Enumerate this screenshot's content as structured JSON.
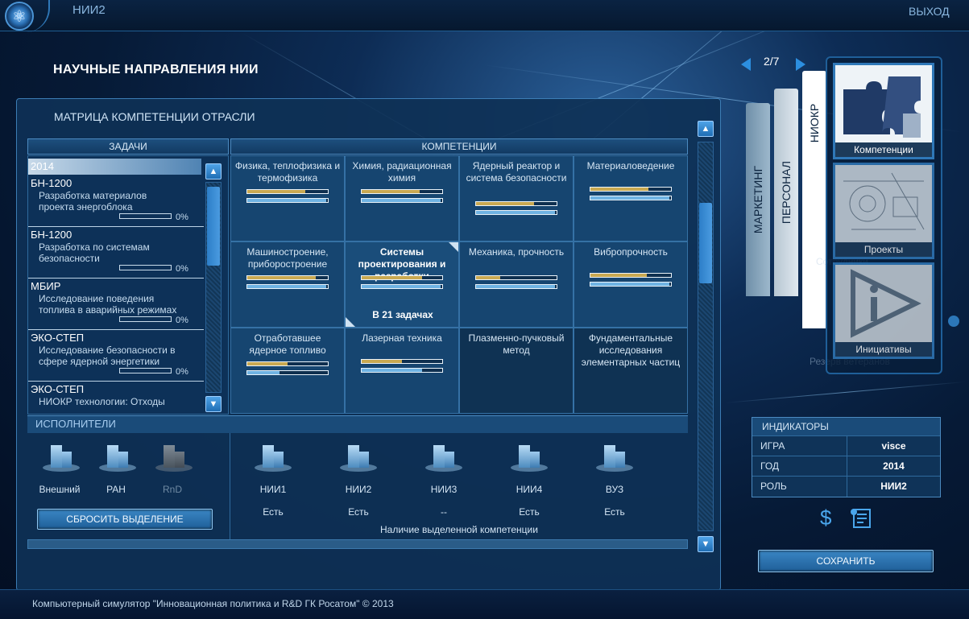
{
  "app": {
    "title": "НИИ2",
    "exit_label": "ВЫХОД",
    "logo_icon": "atom-icon"
  },
  "page_title": "НАУЧНЫЕ НАПРАВЛЕНИЯ НИИ",
  "panel_title": "МАТРИЦА КОМПЕТЕНЦИИ ОТРАСЛИ",
  "headers": {
    "tasks": "ЗАДАЧИ",
    "competencies": "КОМПЕТЕНЦИИ",
    "executors": "ИСПОЛНИТЕЛИ"
  },
  "tasks": {
    "year": "2014",
    "items": [
      {
        "code": "БН-1200",
        "desc": "Разработка материалов проекта энергоблока",
        "progress": "0%"
      },
      {
        "code": "БН-1200",
        "desc": "Разработка по системам безопасности",
        "progress": "0%"
      },
      {
        "code": "МБИР",
        "desc": "Исследование поведения топлива в аварийных режимах",
        "progress": "0%"
      },
      {
        "code": "ЭКО-СТЕП",
        "desc": "Исследование безопасности в сфере ядерной энергетики",
        "progress": "0%"
      },
      {
        "code": "ЭКО-СТЕП",
        "desc": "НИОКР технологии: Отходы",
        "progress": ""
      }
    ]
  },
  "competencies": [
    {
      "label": "Физика, теплофизика и термофизика",
      "gold": 0.72,
      "blue": 0.98
    },
    {
      "label": "Химия, радиационная химия",
      "gold": 0.72,
      "blue": 0.98
    },
    {
      "label": "Ядерный реактор и система безопасности",
      "gold": 0.72,
      "blue": 0.98
    },
    {
      "label": "Материаловедение",
      "gold": 0.72,
      "blue": 0.98
    },
    {
      "label": "Машиностроение, приборостроение",
      "gold": 0.85,
      "blue": 0.98
    },
    {
      "label": "Системы проектирования и разработки",
      "gold": 0.75,
      "blue": 0.98,
      "selected": true,
      "tasks_note": "В 21 задачах"
    },
    {
      "label": "Механика, прочность",
      "gold": 0.3,
      "blue": 0.98
    },
    {
      "label": "Вибропрочность",
      "gold": 0.7,
      "blue": 0.98
    },
    {
      "label": "Отработавшее ядерное топливо",
      "gold": 0.5,
      "blue": 0.4
    },
    {
      "label": "Лазерная техника",
      "gold": 0.5,
      "blue": 0.75
    },
    {
      "label": "Плазменно-пучковый метод",
      "empty": true
    },
    {
      "label": "Фундаментальные исследования элементарных частиц",
      "empty": true
    }
  ],
  "executors_left": [
    {
      "label": "Внешний",
      "active": true
    },
    {
      "label": "РАН",
      "active": true
    },
    {
      "label": "RnD",
      "active": false
    }
  ],
  "executors_right": [
    {
      "label": "НИИ1",
      "status": "Есть"
    },
    {
      "label": "НИИ2",
      "status": "Есть"
    },
    {
      "label": "НИИ3",
      "status": "--"
    },
    {
      "label": "НИИ4",
      "status": "Есть"
    },
    {
      "label": "ВУЗ",
      "status": "Есть"
    }
  ],
  "reset_label": "СБРОСИТЬ ВЫДЕЛЕНИЕ",
  "competence_note": "Наличие выделенной компетенции",
  "pager": "2/7",
  "side_tabs": [
    "МАРКЕТИНГ",
    "ПЕРСОНАЛ",
    "НИОКР"
  ],
  "cards": [
    {
      "label": "Компетенции",
      "icon": "puzzle-icon"
    },
    {
      "label": "Проекты",
      "icon": "blueprint-icon"
    },
    {
      "label": "Инициативы",
      "icon": "play-icon"
    }
  ],
  "background_text": [
    "Резерв ветеранов",
    "Сотрудники"
  ],
  "indicators": {
    "title": "ИНДИКАТОРЫ",
    "rows": [
      {
        "key": "ИГРА",
        "value": "visce"
      },
      {
        "key": "ГОД",
        "value": "2014"
      },
      {
        "key": "РОЛЬ",
        "value": "НИИ2"
      }
    ]
  },
  "icons": {
    "money": "$",
    "document": "document-icon"
  },
  "save_label": "СОХРАНИТЬ",
  "footer": "Компьютерный симулятор \"Инновационная политика и R&D ГК Росатом\" © 2013"
}
